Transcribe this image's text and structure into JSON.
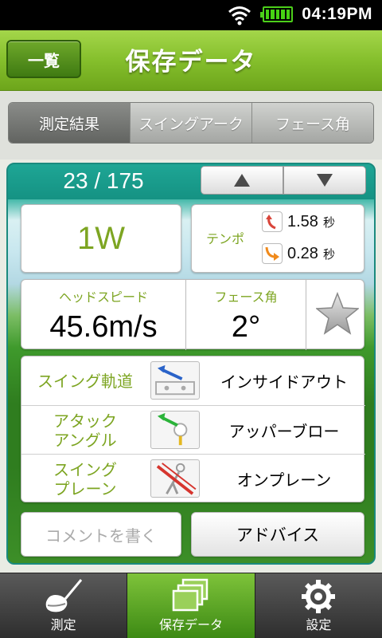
{
  "status_bar": {
    "time": "04:19PM"
  },
  "header": {
    "back_label": "一覧",
    "title": "保存データ"
  },
  "tabs": [
    {
      "label": "測定結果",
      "active": true
    },
    {
      "label": "スイングアーク",
      "active": false
    },
    {
      "label": "フェース角",
      "active": false
    }
  ],
  "record": {
    "counter": "23 / 175",
    "club": "1W"
  },
  "tempo": {
    "label": "テンポ",
    "backswing": {
      "value": "1.58",
      "unit": "秒"
    },
    "downswing": {
      "value": "0.28",
      "unit": "秒"
    }
  },
  "metrics": {
    "head_speed": {
      "label": "ヘッドスピード",
      "value": "45.6m/s"
    },
    "face_angle": {
      "label": "フェース角",
      "value": "2°"
    }
  },
  "swing_table": [
    {
      "label": "スイング軌道",
      "value": "インサイドアウト"
    },
    {
      "label": "アタック\nアングル",
      "value": "アッパーブロー"
    },
    {
      "label": "スイング\nプレーン",
      "value": "オンプレーン"
    }
  ],
  "actions": {
    "comment_placeholder": "コメントを書く",
    "advice_label": "アドバイス"
  },
  "bottom_nav": [
    {
      "label": "測定",
      "icon": "golf-club-icon",
      "active": false
    },
    {
      "label": "保存データ",
      "icon": "stacked-pages-icon",
      "active": true
    },
    {
      "label": "設定",
      "icon": "gear-icon",
      "active": false
    }
  ],
  "colors": {
    "accent_green": "#7da522",
    "header_green": "#85bf2c",
    "panel_teal": "#1ea695"
  }
}
